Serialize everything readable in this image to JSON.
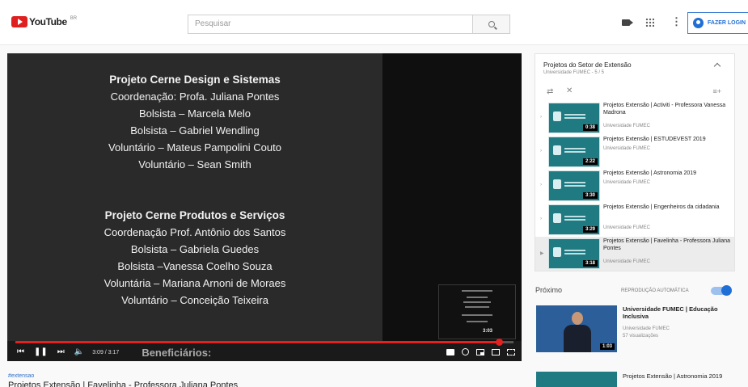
{
  "header": {
    "logo_text": "YouTube",
    "logo_superscript": "BR",
    "search_placeholder": "Pesquisar",
    "login_label": "FAZER LOGIN"
  },
  "player": {
    "credits_block_1": {
      "heading": "Projeto Cerne Design e Sistemas",
      "lines": [
        "Coordenação: Profa. Juliana Pontes",
        "Bolsista – Marcela Melo",
        "Bolsista – Gabriel Wendling",
        "Voluntário – Mateus Pampolini Couto",
        "Voluntário – Sean Smith"
      ]
    },
    "credits_block_2": {
      "heading": "Projeto Cerne Produtos e Serviços",
      "lines": [
        "Coordenação Prof. Antônio dos Santos",
        "Bolsista – Gabriela Guedes",
        "Bolsista –Vanessa Coelho Souza",
        "Voluntária – Mariana Arnoni de Moraes",
        "Voluntário – Conceição Teixeira"
      ]
    },
    "preview_time": "3:03",
    "time_display": "3:09 / 3:17",
    "progress_fraction": 0.97,
    "overlay_caption": "Beneficiários:"
  },
  "video_info": {
    "hashtag": "#extensao",
    "title": "Projetos Extensão | Favelinha - Professora Juliana Pontes"
  },
  "playlist": {
    "title": "Projetos do Setor de Extensão",
    "subtitle": "Universidade FUMEC - 5 / 5",
    "items": [
      {
        "title": "Projetos Extensão | Activiti - Professora Vanessa Madrona",
        "channel": "Universidade FUMEC",
        "duration": "0:38",
        "marker": "›"
      },
      {
        "title": "Projetos Extensão | ESTUDEVEST 2019",
        "channel": "Universidade FUMEC",
        "duration": "2:22",
        "marker": "›"
      },
      {
        "title": "Projetos Extensão | Astronomia 2019",
        "channel": "Universidade FUMEC",
        "duration": "3:30",
        "marker": "›"
      },
      {
        "title": "Projetos Extensão | Engenheiros da cidadania",
        "channel": "Universidade FUMEC",
        "duration": "3:29",
        "marker": "›"
      },
      {
        "title": "Projetos Extensão | Favelinha - Professora Juliana Pontes",
        "channel": "Universidade FUMEC",
        "duration": "3:18",
        "marker": "▶"
      }
    ]
  },
  "next": {
    "label": "Próximo",
    "autoplay_label": "REPRODUÇÃO AUTOMÁTICA",
    "autoplay_on": true,
    "video": {
      "title": "Universidade FUMEC | Educação Inclusiva",
      "channel": "Universidade FUMEC",
      "views": "57 visualizações",
      "duration": "1:03"
    }
  },
  "recommended": [
    {
      "title": "Projetos Extensão | Astronomia 2019"
    }
  ],
  "colors": {
    "brand_red": "#e02020",
    "accent_blue": "#1f6fd6",
    "progress_red": "#e52020"
  }
}
